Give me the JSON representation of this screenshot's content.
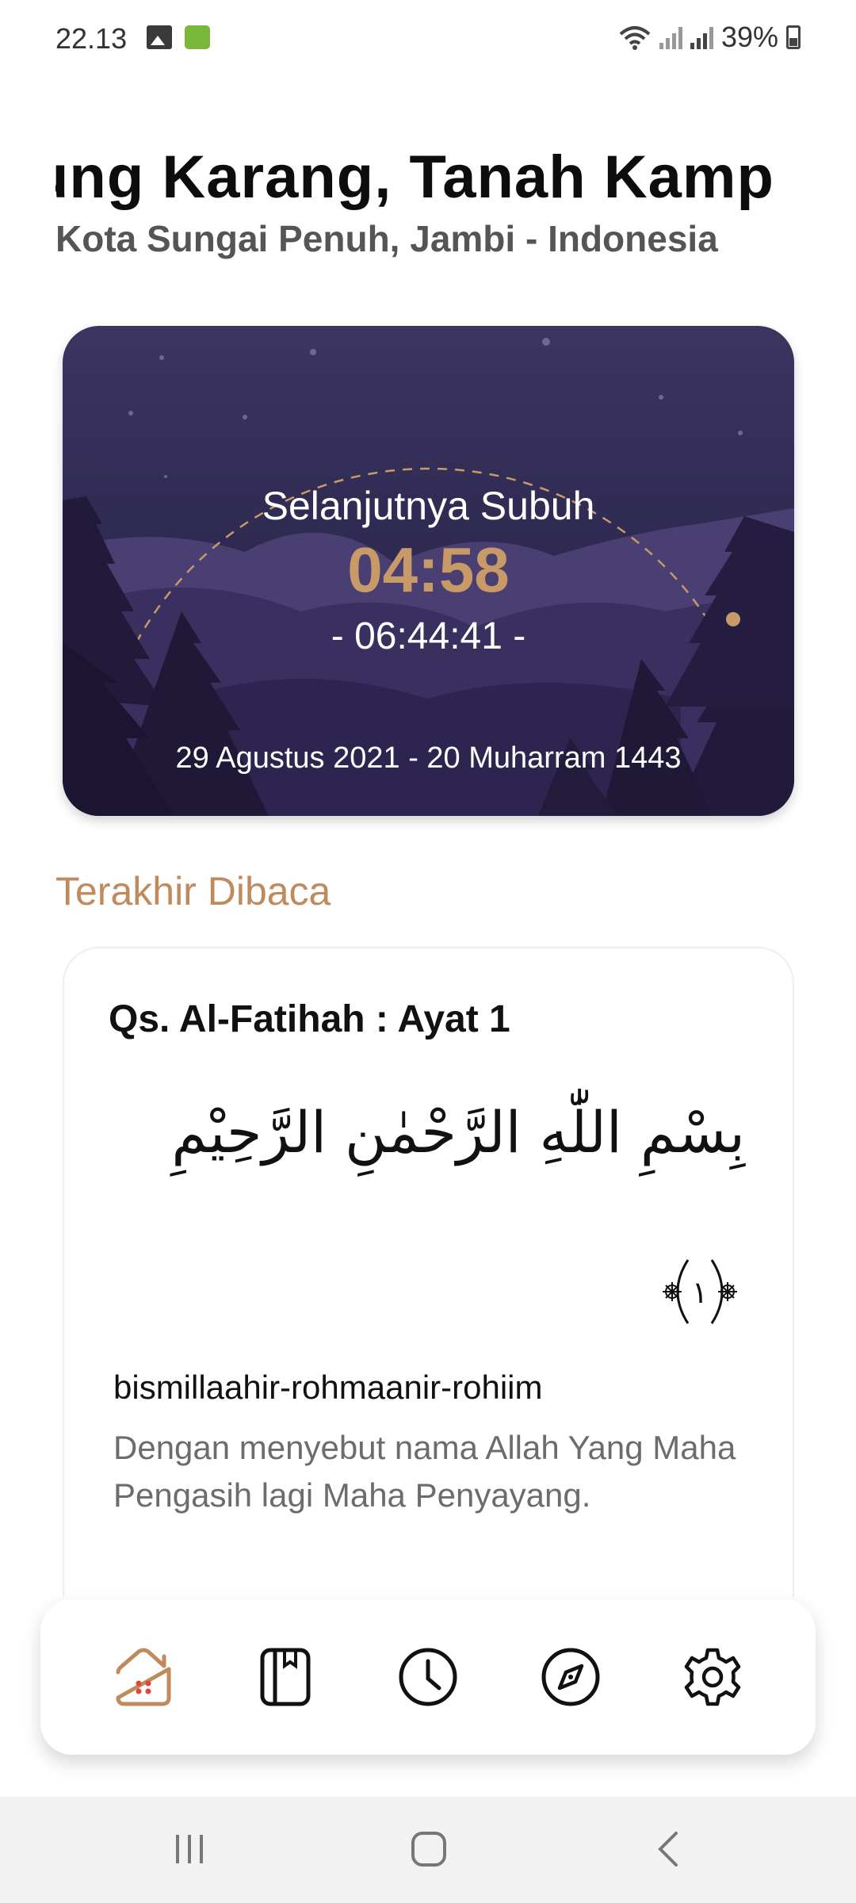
{
  "status_bar": {
    "time": "22.13",
    "battery": "39%"
  },
  "location": {
    "title": "ung Karang, Tanah Kamp",
    "subtitle": "Kota Sungai Penuh, Jambi - Indonesia"
  },
  "prayer_card": {
    "next_label": "Selanjutnya Subuh",
    "next_time": "04:58",
    "countdown": "- 06:44:41 -",
    "date": "29 Agustus 2021 - 20 Muharram 1443"
  },
  "last_read": {
    "section_title": "Terakhir Dibaca",
    "surah_ref": "Qs. Al-Fatihah : Ayat 1",
    "arabic": "بِسْمِ اللّٰهِ الرَّحْمٰنِ الرَّحِيْمِ",
    "ayah_number": "١",
    "transliteration": "bismillaahir-rohmaanir-rohiim",
    "translation": "Dengan menyebut nama Allah Yang Maha Pengasih lagi Maha Penyayang."
  },
  "bottom_nav": {
    "items": [
      {
        "icon": "home-icon",
        "active": true
      },
      {
        "icon": "quran-book-icon",
        "active": false
      },
      {
        "icon": "clock-icon",
        "active": false
      },
      {
        "icon": "compass-icon",
        "active": false
      },
      {
        "icon": "gear-icon",
        "active": false
      }
    ],
    "active_color": "#c08b5c"
  },
  "colors": {
    "accent": "#c08b5c",
    "card_bg": "#2f2a52",
    "prayer_time": "#c79a68"
  }
}
